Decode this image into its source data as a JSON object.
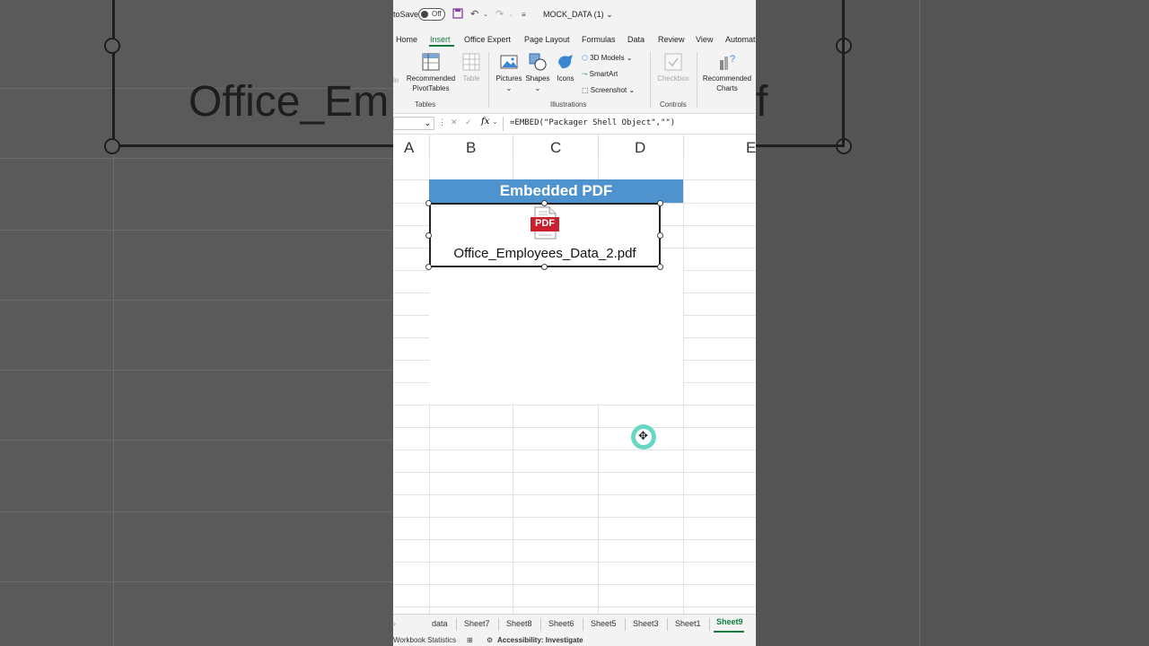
{
  "background": {
    "text_left": "Office_Em",
    "text_right": "f"
  },
  "titlebar": {
    "autosave_label": "toSave",
    "autosave_state": "Off",
    "document_name": "MOCK_DATA (1) ⌄"
  },
  "tabs": [
    "Home",
    "Insert",
    "Office Expert",
    "Page Layout",
    "Formulas",
    "Data",
    "Review",
    "View",
    "Automat"
  ],
  "ribbon": {
    "tables": {
      "partial_label": "le",
      "recommended_pivot_line1": "Recommended",
      "recommended_pivot_line2": "PivotTables",
      "table": "Table",
      "group": "Tables"
    },
    "illustrations": {
      "pictures": "Pictures",
      "shapes": "Shapes",
      "icons": "Icons",
      "models_3d": "3D Models",
      "smartart": "SmartArt",
      "screenshot": "Screenshot",
      "group": "Illustrations"
    },
    "controls": {
      "checkbox": "Checkbox",
      "group": "Controls"
    },
    "charts": {
      "line1": "Recommended",
      "line2": "Charts"
    }
  },
  "formula_bar": {
    "fx": "fx",
    "formula": "=EMBED(\"Packager Shell Object\",\"\")"
  },
  "columns": [
    "A",
    "B",
    "C",
    "D",
    "E"
  ],
  "sheet": {
    "header_cell": "Embedded PDF",
    "embedded_filename": "Office_Employees_Data_2.pdf",
    "pdf_badge": "PDF"
  },
  "sheet_tabs": [
    "data",
    "Sheet7",
    "Sheet8",
    "Sheet6",
    "Sheet5",
    "Sheet3",
    "Sheet1",
    "Sheet9"
  ],
  "statusbar": {
    "workbook_stats": "Workbook Statistics",
    "accessibility": "Accessibility: Investigate"
  },
  "colors": {
    "accent": "#107c41",
    "header_fill": "#4f93ce",
    "pdf_red": "#c8202f",
    "cursor": "#6ad6c4"
  }
}
